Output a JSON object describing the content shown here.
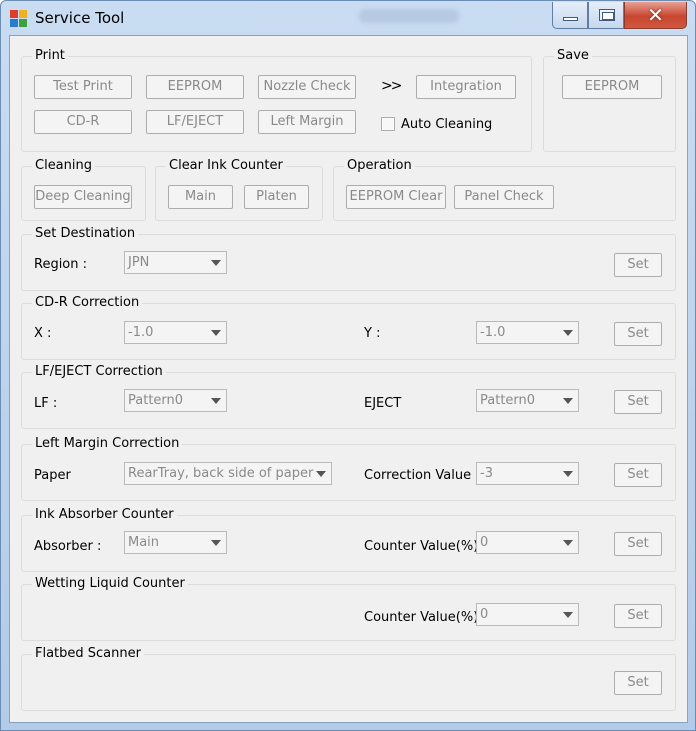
{
  "window": {
    "title": "Service Tool"
  },
  "print": {
    "label": "Print",
    "test_print": "Test Print",
    "eeprom": "EEPROM",
    "nozzle_check": "Nozzle Check",
    "chevrons": ">>",
    "integration": "Integration",
    "cdr": "CD-R",
    "lf_eject": "LF/EJECT",
    "left_margin": "Left Margin",
    "auto_cleaning": "Auto Cleaning"
  },
  "save": {
    "label": "Save",
    "eeprom": "EEPROM"
  },
  "cleaning": {
    "label": "Cleaning",
    "deep_cleaning": "Deep Cleaning"
  },
  "clear_ink": {
    "label": "Clear Ink Counter",
    "main": "Main",
    "platen": "Platen"
  },
  "operation": {
    "label": "Operation",
    "eeprom_clear": "EEPROM Clear",
    "panel_check": "Panel Check"
  },
  "set_destination": {
    "label": "Set Destination",
    "region_label": "Region :",
    "region_value": "JPN",
    "set": "Set"
  },
  "cdr_correction": {
    "label": "CD-R Correction",
    "x_label": "X :",
    "x_value": "-1.0",
    "y_label": "Y :",
    "y_value": "-1.0",
    "set": "Set"
  },
  "lf_correction": {
    "label": "LF/EJECT Correction",
    "lf_label": "LF :",
    "lf_value": "Pattern0",
    "eject_label": "EJECT",
    "eject_value": "Pattern0",
    "set": "Set"
  },
  "left_margin_correction": {
    "label": "Left Margin Correction",
    "paper_label": "Paper",
    "paper_value": "RearTray, back side of paper",
    "correction_label": "Correction Value",
    "correction_value": "-3",
    "set": "Set"
  },
  "ink_absorber": {
    "label": "Ink Absorber Counter",
    "absorber_label": "Absorber :",
    "absorber_value": "Main",
    "counter_label": "Counter Value(%)",
    "counter_value": "0",
    "set": "Set"
  },
  "wetting": {
    "label": "Wetting Liquid Counter",
    "counter_label": "Counter Value(%)",
    "counter_value": "0",
    "set": "Set"
  },
  "flatbed": {
    "label": "Flatbed Scanner",
    "set": "Set"
  }
}
